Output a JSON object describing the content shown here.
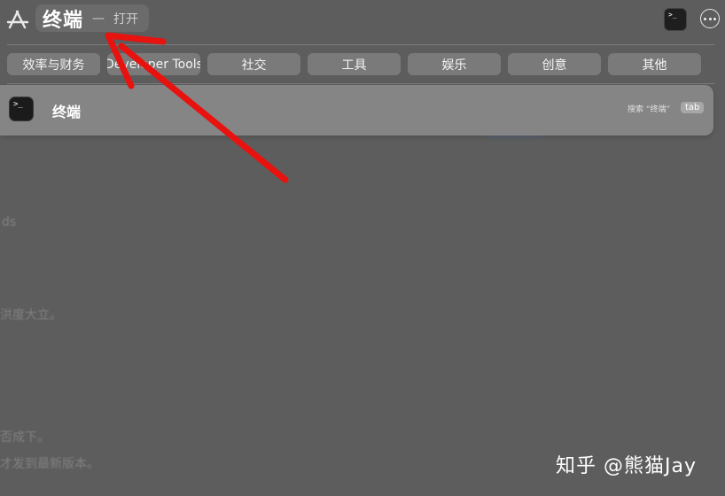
{
  "search": {
    "title": "终端",
    "separator": "—",
    "action": "打开"
  },
  "categories": [
    "效率与财务",
    "Developer Tools",
    "社交",
    "工具",
    "娱乐",
    "创意",
    "其他"
  ],
  "result": {
    "title": "终端",
    "hint": "搜索 “终端”",
    "badge": "tab"
  },
  "terminal_icon_text": ">_",
  "background_fragments": [
    "ds",
    "洪度大立。",
    "否成下。",
    "才发到最新版本。"
  ],
  "watermark": "知乎 @熊猫Jay",
  "colors": {
    "arrow": "#e8120f",
    "accent_blob": "#4f79b5"
  },
  "icons": [
    "app-store-icon",
    "terminal-icon",
    "more-options-icon"
  ]
}
